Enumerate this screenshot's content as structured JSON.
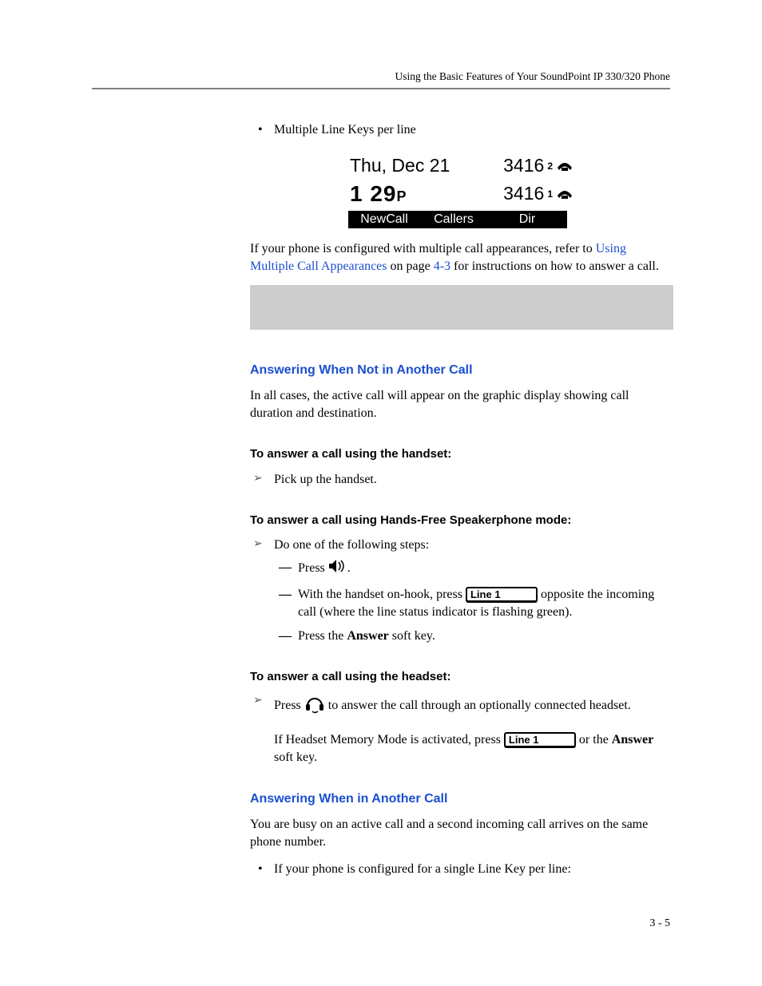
{
  "header": {
    "running": "Using the Basic Features of Your SoundPoint IP 330/320 Phone"
  },
  "bullets": {
    "multi_line_keys": "Multiple Line Keys per line"
  },
  "lcd": {
    "date": "Thu, Dec 21",
    "ext_a": "3416",
    "ext_a_badge": "2",
    "time_main": "1 29",
    "time_suffix": "P",
    "ext_b": "3416",
    "ext_b_badge": "1",
    "soft": {
      "newcall": "NewCall",
      "callers": "Callers",
      "dir": "Dir"
    }
  },
  "p_configured": {
    "pre": "If your phone is configured with multiple call appearances, refer to ",
    "link1": "Using Multiple Call Appearances",
    "mid": " on page ",
    "link2": "4-3",
    "post": " for instructions on how to answer a call."
  },
  "sections": {
    "not_in_call_h": "Answering When Not in Another Call",
    "not_in_call_p": "In all cases, the active call will appear on the graphic display showing call duration and destination.",
    "handset_h": "To answer a call using the handset:",
    "handset_step": "Pick up the handset.",
    "hf_h": "To answer a call using Hands-Free Speakerphone mode:",
    "hf_step_intro": "Do one of the following steps:",
    "hf_dash1_pre": "Press ",
    "hf_dash1_post": ".",
    "hf_dash2_pre": "With the handset on-hook, press ",
    "hf_dash2_post": " opposite the incoming call (where the line status indicator is flashing green).",
    "hf_dash3_pre": "Press the ",
    "hf_dash3_bold": "Answer",
    "hf_dash3_post": " soft key.",
    "headset_h": "To answer a call using the headset:",
    "headset_step_pre": "Press ",
    "headset_step_post": " to answer the call through an optionally connected headset.",
    "headset_p2_pre": "If Headset Memory Mode is activated, press ",
    "headset_p2_mid": " or the ",
    "headset_p2_bold": "Answer",
    "headset_p2_post": " soft key.",
    "in_call_h": "Answering When in Another Call",
    "in_call_p": "You are busy on an active call and a second incoming call arrives on the same phone number.",
    "in_call_bullet": "If your phone is configured for a single Line Key per line:"
  },
  "labels": {
    "line1": "Line 1"
  },
  "footer": {
    "pagenum": "3 - 5"
  }
}
